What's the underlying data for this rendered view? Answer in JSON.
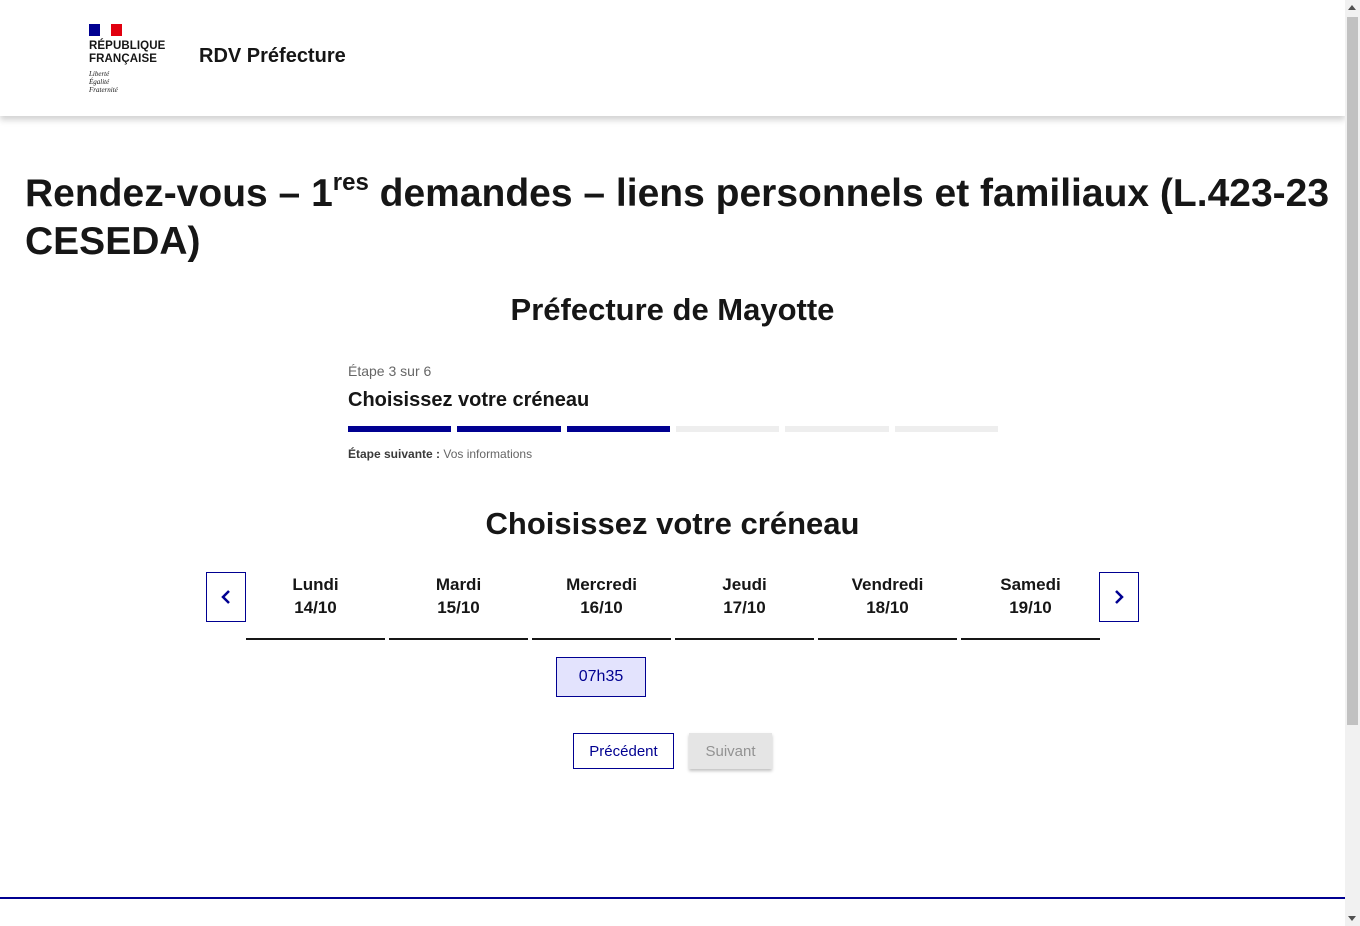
{
  "header": {
    "logo_text_line1": "RÉPUBLIQUE",
    "logo_text_line2": "FRANÇAISE",
    "motto_line1": "Liberté",
    "motto_line2": "Égalité",
    "motto_line3": "Fraternité",
    "site_title": "RDV Préfecture"
  },
  "main": {
    "title_part1": "Rendez-vous – 1",
    "title_sup": "res",
    "title_part2": " demandes – liens personnels et familiaux (L.423-23 CESEDA)",
    "prefecture": "Préfecture de Mayotte"
  },
  "stepper": {
    "count": "Étape 3 sur 6",
    "title": "Choisissez votre créneau",
    "current_step": 3,
    "total_steps": 6,
    "next_label": "Étape suivante :",
    "next_value": " Vos informations"
  },
  "slots": {
    "heading": "Choisissez votre créneau",
    "prev_icon": "chevron-left-icon",
    "next_icon": "chevron-right-icon",
    "days": [
      {
        "name": "Lundi",
        "date": "14/10"
      },
      {
        "name": "Mardi",
        "date": "15/10"
      },
      {
        "name": "Mercredi",
        "date": "16/10"
      },
      {
        "name": "Jeudi",
        "date": "17/10"
      },
      {
        "name": "Vendredi",
        "date": "18/10"
      },
      {
        "name": "Samedi",
        "date": "19/10"
      }
    ],
    "available": [
      {
        "day": "Mercredi",
        "time": "07h35"
      }
    ]
  },
  "actions": {
    "previous": "Précédent",
    "next": "Suivant"
  },
  "colors": {
    "primary": "#000091",
    "slot_bg": "#e3e3fd",
    "disabled_bg": "#e5e5e5",
    "disabled_text": "#929292",
    "flag_red": "#e1000f"
  }
}
